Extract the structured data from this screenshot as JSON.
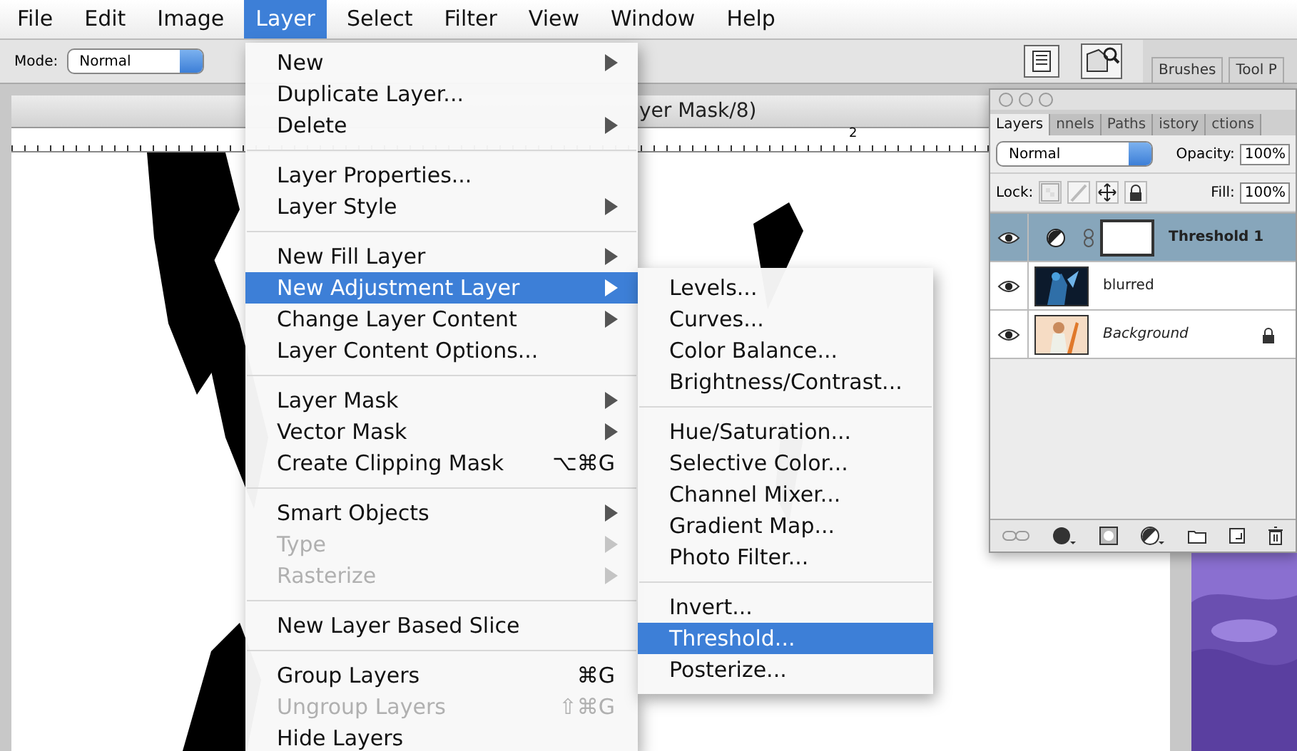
{
  "menubar": {
    "items": [
      {
        "label": "File",
        "selected": false
      },
      {
        "label": "Edit",
        "selected": false
      },
      {
        "label": "Image",
        "selected": false
      },
      {
        "label": "Layer",
        "selected": true
      },
      {
        "label": "Select",
        "selected": false
      },
      {
        "label": "Filter",
        "selected": false
      },
      {
        "label": "View",
        "selected": false
      },
      {
        "label": "Window",
        "selected": false
      },
      {
        "label": "Help",
        "selected": false
      }
    ]
  },
  "options_bar": {
    "mode_label": "Mode:",
    "mode": "Normal",
    "palette_tabs": [
      "Brushes",
      "Tool P"
    ]
  },
  "document": {
    "title": "yer Mask/8)",
    "ruler_label": "2"
  },
  "layer_menu": {
    "items": [
      {
        "kind": "item",
        "label": "New",
        "submenu": true,
        "disabled": false,
        "selected": false
      },
      {
        "kind": "item",
        "label": "Duplicate Layer...",
        "submenu": false,
        "disabled": false,
        "selected": false
      },
      {
        "kind": "item",
        "label": "Delete",
        "submenu": true,
        "disabled": false,
        "selected": false
      },
      {
        "kind": "separator"
      },
      {
        "kind": "item",
        "label": "Layer Properties...",
        "submenu": false,
        "disabled": false,
        "selected": false
      },
      {
        "kind": "item",
        "label": "Layer Style",
        "submenu": true,
        "disabled": false,
        "selected": false
      },
      {
        "kind": "separator"
      },
      {
        "kind": "item",
        "label": "New Fill Layer",
        "submenu": true,
        "disabled": false,
        "selected": false
      },
      {
        "kind": "item",
        "label": "New Adjustment Layer",
        "submenu": true,
        "disabled": false,
        "selected": true
      },
      {
        "kind": "item",
        "label": "Change Layer Content",
        "submenu": true,
        "disabled": false,
        "selected": false
      },
      {
        "kind": "item",
        "label": "Layer Content Options...",
        "submenu": false,
        "disabled": false,
        "selected": false
      },
      {
        "kind": "separator"
      },
      {
        "kind": "item",
        "label": "Layer Mask",
        "submenu": true,
        "disabled": false,
        "selected": false
      },
      {
        "kind": "item",
        "label": "Vector Mask",
        "submenu": true,
        "disabled": false,
        "selected": false
      },
      {
        "kind": "item",
        "label": "Create Clipping Mask",
        "shortcut": "⌥⌘G",
        "submenu": false,
        "disabled": false,
        "selected": false
      },
      {
        "kind": "separator"
      },
      {
        "kind": "item",
        "label": "Smart Objects",
        "submenu": true,
        "disabled": false,
        "selected": false
      },
      {
        "kind": "item",
        "label": "Type",
        "submenu": true,
        "disabled": true,
        "selected": false
      },
      {
        "kind": "item",
        "label": "Rasterize",
        "submenu": true,
        "disabled": true,
        "selected": false
      },
      {
        "kind": "separator"
      },
      {
        "kind": "item",
        "label": "New Layer Based Slice",
        "submenu": false,
        "disabled": false,
        "selected": false
      },
      {
        "kind": "separator"
      },
      {
        "kind": "item",
        "label": "Group Layers",
        "shortcut": "⌘G",
        "submenu": false,
        "disabled": false,
        "selected": false
      },
      {
        "kind": "item",
        "label": "Ungroup Layers",
        "shortcut": "⇧⌘G",
        "submenu": false,
        "disabled": true,
        "selected": false
      },
      {
        "kind": "item",
        "label": "Hide Layers",
        "submenu": false,
        "disabled": false,
        "selected": false
      }
    ]
  },
  "submenu": {
    "items": [
      {
        "kind": "item",
        "label": "Levels...",
        "selected": false
      },
      {
        "kind": "item",
        "label": "Curves...",
        "selected": false
      },
      {
        "kind": "item",
        "label": "Color Balance...",
        "selected": false
      },
      {
        "kind": "item",
        "label": "Brightness/Contrast...",
        "selected": false
      },
      {
        "kind": "separator"
      },
      {
        "kind": "item",
        "label": "Hue/Saturation...",
        "selected": false
      },
      {
        "kind": "item",
        "label": "Selective Color...",
        "selected": false
      },
      {
        "kind": "item",
        "label": "Channel Mixer...",
        "selected": false
      },
      {
        "kind": "item",
        "label": "Gradient Map...",
        "selected": false
      },
      {
        "kind": "item",
        "label": "Photo Filter...",
        "selected": false
      },
      {
        "kind": "separator"
      },
      {
        "kind": "item",
        "label": "Invert...",
        "selected": false
      },
      {
        "kind": "item",
        "label": "Threshold...",
        "selected": true
      },
      {
        "kind": "item",
        "label": "Posterize...",
        "selected": false
      }
    ]
  },
  "layers_panel": {
    "tabs": [
      {
        "label": "Layers",
        "selected": true
      },
      {
        "label": "nnels",
        "selected": false
      },
      {
        "label": "Paths",
        "selected": false
      },
      {
        "label": "istory",
        "selected": false
      },
      {
        "label": "ctions",
        "selected": false
      }
    ],
    "blend_mode": "Normal",
    "opacity_label": "Opacity:",
    "opacity": "100%",
    "lock_label": "Lock:",
    "fill_label": "Fill:",
    "fill": "100%",
    "layers": [
      {
        "name": "Threshold 1",
        "kind": "adjustment",
        "selected": true,
        "visible": true,
        "locked": false
      },
      {
        "name": "blurred",
        "kind": "layer",
        "selected": false,
        "visible": true,
        "locked": false
      },
      {
        "name": "Background",
        "kind": "background",
        "selected": false,
        "visible": true,
        "locked": true
      }
    ]
  }
}
